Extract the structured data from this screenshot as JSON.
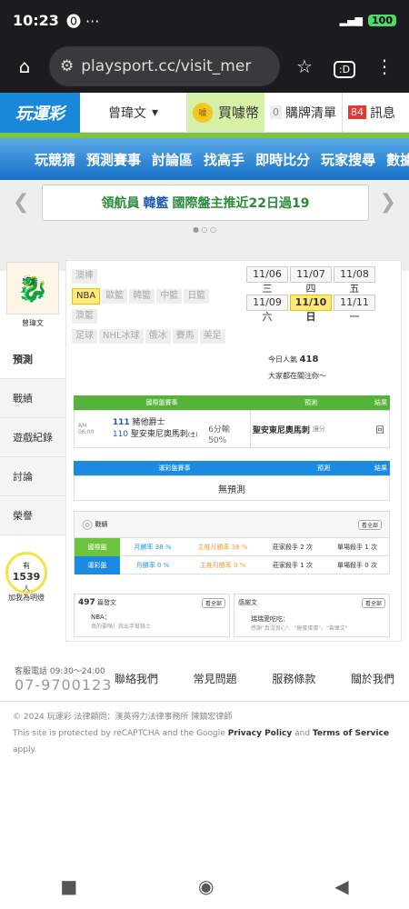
{
  "status": {
    "time": "10:23",
    "icons": "⓿ ···",
    "battery": "100"
  },
  "browser": {
    "url": "playsport.cc/visit_mer",
    "tabs": ":D"
  },
  "header": {
    "logo": "玩運彩",
    "user": "曾瑋文",
    "buy_coin": "買噱幣",
    "list_count": "0",
    "list_label": "購牌清單",
    "msg_count": "84",
    "msg_label": "訊息"
  },
  "nav": [
    "玩競猜",
    "預測賽事",
    "討論區",
    "找高手",
    "即時比分",
    "玩家搜尋",
    "數據"
  ],
  "banner": {
    "pre": "領航員",
    "highlight": "韓籃",
    "post": "國際盤主推近22日過19"
  },
  "profile": {
    "name": "曾瑋文"
  },
  "side_menu": [
    "預測",
    "戰績",
    "遊戲紀錄",
    "討論",
    "榮譽"
  ],
  "popularity": {
    "prefix": "有",
    "count": "1539",
    "unit": "人",
    "label": "加我為明燈"
  },
  "leagues": {
    "row1": [
      "澳棒"
    ],
    "row2": [
      "NBA",
      "歐籃",
      "韓籃",
      "中籃",
      "日籃"
    ],
    "row3": [
      "澳籃"
    ],
    "row4": [
      "足球",
      "NHL冰球",
      "俄冰",
      "賽馬",
      "美足"
    ]
  },
  "dates": [
    "11/06 三",
    "11/07 四",
    "11/08 五",
    "11/09 六",
    "11/10 日",
    "11/11 一"
  ],
  "views": {
    "label": "今日人氣",
    "count": "418",
    "sub": "大家都在關注你～"
  },
  "intl": {
    "h1": "國際盤賽事",
    "h2": "預測",
    "h3": "結果",
    "time": "AM 06:00",
    "team1_no": "111",
    "team1": "豬他爵士",
    "team2_no": "110",
    "team2": "聖安東尼奧馬刺",
    "team2_tag": "(主)",
    "spread": "6分輸",
    "pct": "50%",
    "pick": "聖安東尼奧馬刺",
    "pick_type": "讓分",
    "result": "回"
  },
  "lottery": {
    "h1": "運彩盤賽事",
    "h2": "預測",
    "h3": "結果",
    "none": "無預測"
  },
  "stats": {
    "title": "戰績",
    "see_all": "看全部",
    "intl_tag": "國際盤",
    "intl_month": "月勝率 38 %",
    "intl_main": "主推月勝率 38 %",
    "intl_kill": "莊家殺手 2 次",
    "intl_single": "單場殺手 1 次",
    "lot_tag": "運彩盤",
    "lot_month": "月勝率 0 %",
    "lot_main": "主推月勝率 0 %",
    "lot_kill": "莊家殺手 1 次",
    "lot_single": "單場殺手 0 次"
  },
  "cards": {
    "left_count": "497",
    "left_title": "篇發文",
    "left_btn": "看全部",
    "left_text": "NBA：",
    "left_sub": "真的要嗎！我出手幫騎士",
    "right_title": "感謝文",
    "right_btn": "看全部",
    "right_text": "瑞瑞愛吃吃：",
    "right_sub": "感謝\"真沒良心\"、\"饅蛋蛋蛋\"、\"曾瑋文\""
  },
  "footer": {
    "hotline_label": "客服電話 09:30～24:00",
    "hotline": "07-9700123",
    "links": [
      "聯絡我們",
      "常見問題",
      "服務條款",
      "關於我們"
    ],
    "copyright": "© 2024 玩運彩 法律顧問：漢英得力法律事務所 陳鎮宏律師",
    "recaptcha_pre": "This site is protected by reCAPTCHA and the Google",
    "privacy": "Privacy Policy",
    "and": "and",
    "terms": "Terms of Service",
    "apply": "apply."
  }
}
